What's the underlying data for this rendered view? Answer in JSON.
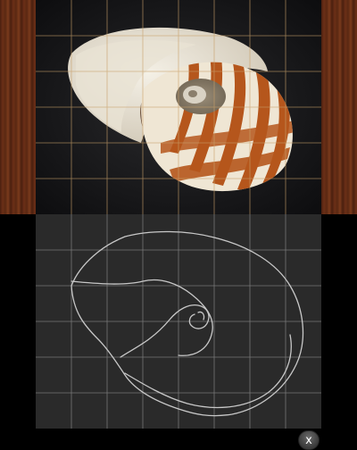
{
  "top_screen": {
    "reference_image": "nautilus-shell-photo"
  },
  "bottom_screen": {
    "close_button_label": "x"
  },
  "colors": {
    "grid_line": "#c8a06a",
    "canvas_bg": "#2a2a2a",
    "sketch_stroke": "#c8c8c8",
    "shell_stripe": "#b5561c"
  }
}
